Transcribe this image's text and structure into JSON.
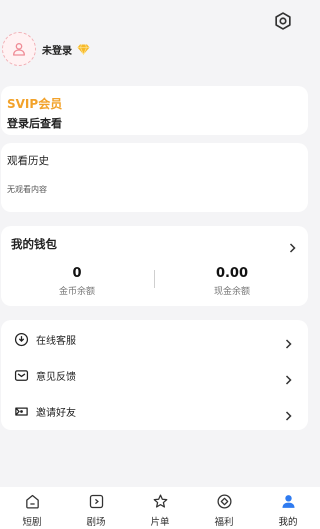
{
  "header": {
    "login_label": "未登录",
    "settings_icon": "settings-icon",
    "vip_icon": "diamond-icon"
  },
  "svip": {
    "title": "SVIP会员",
    "subtitle": "登录后查看"
  },
  "history": {
    "title": "观看历史",
    "empty_text": "无观看内容"
  },
  "wallet": {
    "title": "我的钱包",
    "coin_value": "0",
    "coin_label": "金币余额",
    "cash_value": "0.00",
    "cash_label": "现金余额"
  },
  "menu": {
    "items": [
      {
        "label": "在线客服",
        "icon": "customer-service-icon"
      },
      {
        "label": "意见反馈",
        "icon": "feedback-icon"
      },
      {
        "label": "邀请好友",
        "icon": "invite-icon"
      }
    ]
  },
  "tabbar": {
    "tabs": [
      {
        "label": "短剧",
        "icon": "home-icon"
      },
      {
        "label": "剧场",
        "icon": "theater-icon"
      },
      {
        "label": "片单",
        "icon": "star-icon"
      },
      {
        "label": "福利",
        "icon": "welfare-icon"
      },
      {
        "label": "我的",
        "icon": "profile-icon"
      }
    ],
    "active": "我的"
  },
  "colors": {
    "accent_orange": "#f2a22a",
    "active_blue": "#2f7bf0",
    "avatar_pink": "#f1b0b6",
    "background": "#f4f4f6"
  }
}
